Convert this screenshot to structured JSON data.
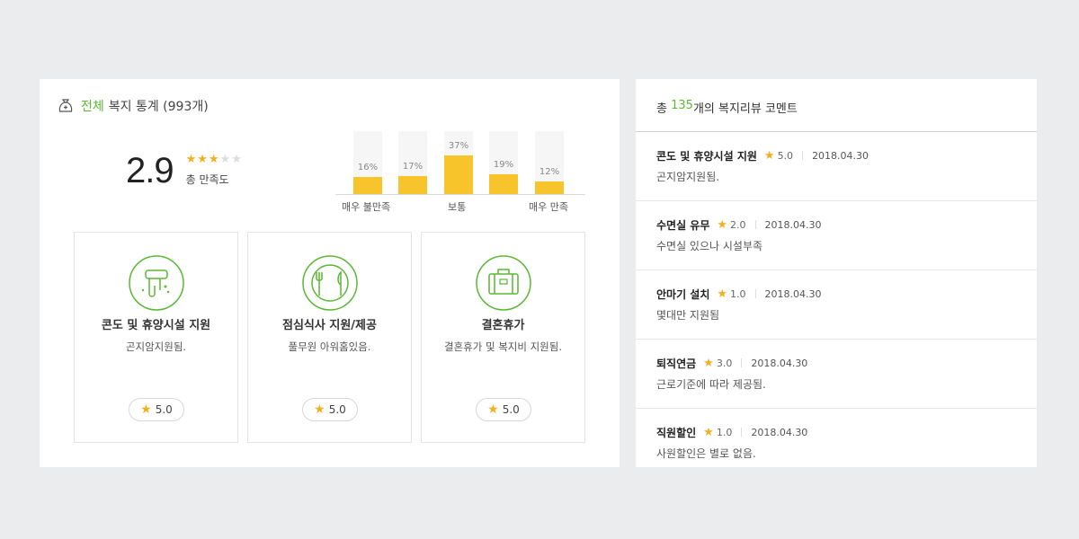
{
  "stats": {
    "title_accent": "전체",
    "title_rest": "복지 통계 (993개)",
    "score": "2.9",
    "score_stars": 3,
    "score_label": "총 만족도",
    "distribution": [
      {
        "pct": "16%",
        "value": 16
      },
      {
        "pct": "17%",
        "value": 17
      },
      {
        "pct": "37%",
        "value": 37
      },
      {
        "pct": "19%",
        "value": 19
      },
      {
        "pct": "12%",
        "value": 12
      }
    ],
    "axis_left": "매우 불만족",
    "axis_mid": "보통",
    "axis_right": "매우 만족"
  },
  "cards": [
    {
      "title": "콘도 및 휴양시설 지원",
      "desc": "곤지암지원됨.",
      "rating": "5.0",
      "icon": "snorkel-icon"
    },
    {
      "title": "점심식사 지원/제공",
      "desc": "풀무원 아워홈있음.",
      "rating": "5.0",
      "icon": "meal-plate-icon"
    },
    {
      "title": "결혼휴가",
      "desc": "결혼휴가 및 복지비 지원됨.",
      "rating": "5.0",
      "icon": "suitcase-icon"
    }
  ],
  "reviews": {
    "header_prefix": "총",
    "count": "135",
    "header_suffix": "개의 복지리뷰 코멘트",
    "items": [
      {
        "title": "콘도 및 휴양시설 지원",
        "score": "5.0",
        "date": "2018.04.30",
        "body": "곤지암지원됨."
      },
      {
        "title": "수면실 유무",
        "score": "2.0",
        "date": "2018.04.30",
        "body": "수면실 있으나 시설부족"
      },
      {
        "title": "안마기 설치",
        "score": "1.0",
        "date": "2018.04.30",
        "body": "몇대만 지원됨"
      },
      {
        "title": "퇴직연금",
        "score": "3.0",
        "date": "2018.04.30",
        "body": "근로기준에 따라 제공됨."
      },
      {
        "title": "직원할인",
        "score": "1.0",
        "date": "2018.04.30",
        "body": "사원할인은 별로 없음."
      }
    ]
  },
  "colors": {
    "accent": "#5ab835",
    "star": "#f2b01e",
    "bar": "#f7c52b"
  }
}
